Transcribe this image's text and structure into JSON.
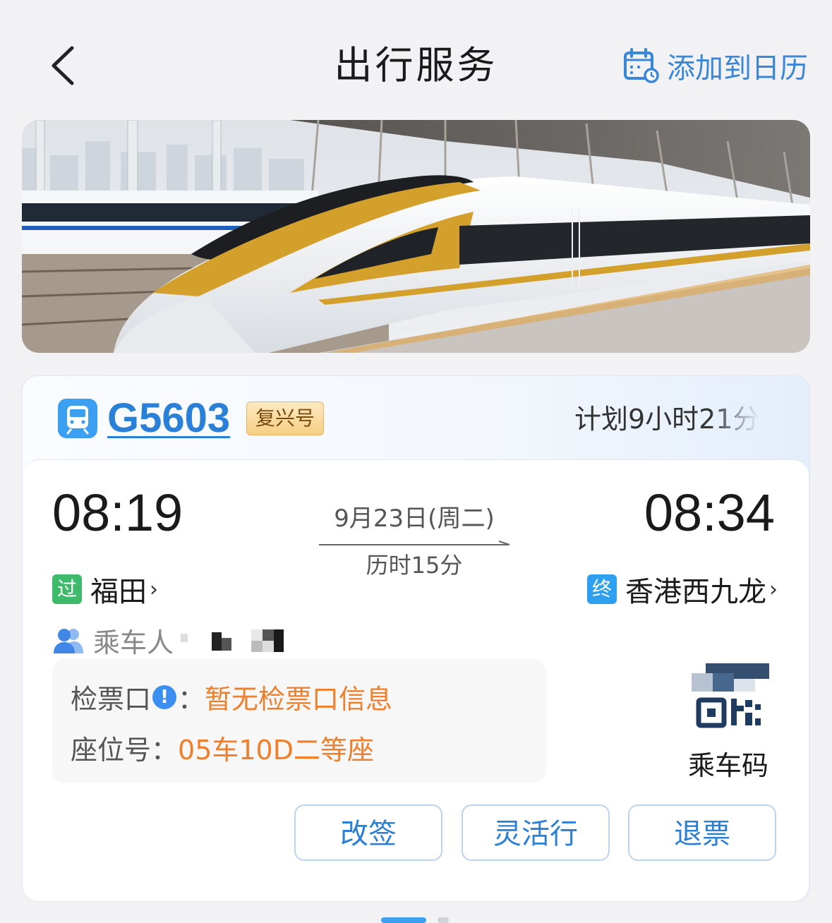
{
  "header": {
    "title": "出行服务",
    "calendar_label": "添加到日历"
  },
  "ticket": {
    "train_no": "G5603",
    "train_type": "复兴号",
    "plan_duration": "计划9小时21分",
    "departure": {
      "time": "08:19",
      "tag": "过",
      "station": "福田",
      "tag_color": "#3dbb6a"
    },
    "arrival": {
      "time": "08:34",
      "tag": "终",
      "station": "香港西九龙",
      "tag_color": "#2f9ff0"
    },
    "date": "9月23日(周二)",
    "elapsed": "历时15分",
    "passenger_label": "乘车人",
    "gate_label": "检票口",
    "gate_value": "暂无检票口信息",
    "seat_label": "座位号：",
    "seat_value": "05车10D二等座",
    "qr_label": "乘车码",
    "actions": [
      "改签",
      "灵活行",
      "退票"
    ]
  },
  "colors": {
    "accent": "#2a7fd6",
    "highlight": "#ef7f2a"
  }
}
